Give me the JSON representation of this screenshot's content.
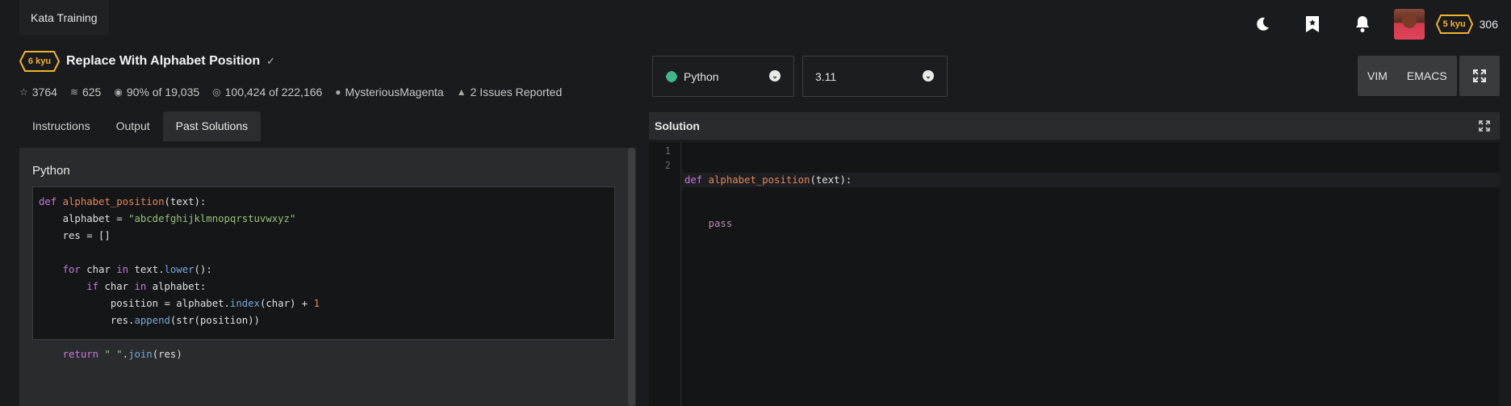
{
  "topbar": {
    "title": "Kata Training",
    "rank": "5 kyu",
    "honor": "306",
    "icons": [
      "moon-icon",
      "bookmark-icon",
      "bell-icon"
    ]
  },
  "kata": {
    "rank": "6 kyu",
    "title": "Replace With Alphabet Position",
    "stats": {
      "stars": "3764",
      "collections": "625",
      "satisfaction": "90%",
      "satisfaction_of": "of 19,035",
      "completed": "100,424",
      "completed_of": "of 222,166",
      "author": "MysteriousMagenta",
      "issues": "2 Issues Reported"
    }
  },
  "tabs": [
    "Instructions",
    "Output",
    "Past Solutions"
  ],
  "active_tab": "Past Solutions",
  "past_solution": {
    "language": "Python",
    "lines": [
      "def alphabet_position(text):",
      "    alphabet = \"abcdefghijklmnopqrstuvwxyz\"",
      "    res = []",
      "",
      "    for char in text.lower():",
      "        if char in alphabet:",
      "            position = alphabet.index(char) + 1",
      "            res.append(str(position))",
      "",
      "    return \" \".join(res)"
    ]
  },
  "editor": {
    "language": "Python",
    "version": "3.11",
    "modes": [
      "VIM",
      "EMACS"
    ],
    "solution_label": "Solution",
    "line_numbers": [
      "1",
      "2"
    ],
    "lines": [
      "def alphabet_position(text):",
      "    pass"
    ]
  },
  "colors": {
    "background": "#1a1b1e",
    "rank_yellow": "#f0b429",
    "python_green": "#3fb68b"
  }
}
